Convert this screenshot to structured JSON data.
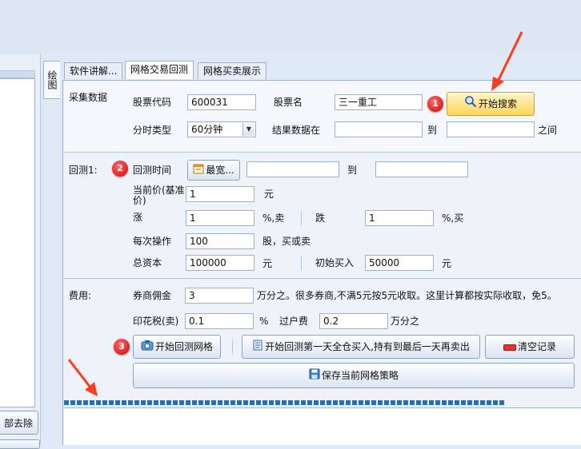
{
  "left": {
    "clear_button_label": "部去除"
  },
  "vertical_tab": {
    "label": "绘图"
  },
  "tabs": [
    {
      "label": "软件讲解..."
    },
    {
      "label": "网格交易回测"
    },
    {
      "label": "网格买卖展示"
    }
  ],
  "collect": {
    "section_label": "采集数据",
    "stock_code_label": "股票代码",
    "stock_code_value": "600031",
    "stock_name_label": "股票名",
    "stock_name_value": "三一重工",
    "search_button": "开始搜索",
    "interval_label": "分时类型",
    "interval_value": "60分钟",
    "result_label": "结果数据在",
    "result_from": "",
    "to_label": "到",
    "result_to": "",
    "between_label": "之间"
  },
  "backtest": {
    "section_label": "回测1:",
    "time_label": "回测时间",
    "browse_button": "最宽...",
    "time_from": "",
    "to_label": "到",
    "time_to": "",
    "current_price_label": "当前价(基准价)",
    "current_price_value": "1",
    "yuan_unit": "元",
    "rise_label": "涨",
    "rise_value": "1",
    "rise_unit": "%,卖",
    "fall_label": "跌",
    "fall_value": "1",
    "fall_unit": "%,买",
    "per_op_label": "每次操作",
    "per_op_value": "100",
    "per_op_unit": "股，买或卖",
    "capital_label": "总资本",
    "capital_value": "100000",
    "capital_unit": "元",
    "initial_buy_label": "初始买入",
    "initial_buy_value": "50000",
    "initial_buy_unit": "元"
  },
  "fees": {
    "section_label": "费用:",
    "commission_label": "券商佣金",
    "commission_value": "3",
    "commission_note": "万分之。很多券商,不满5元按5元收取。这里计算都按实际收取，免5。",
    "stamp_label": "印花税(卖)",
    "stamp_value": "0.1",
    "stamp_unit": "%",
    "transfer_label": "过户费",
    "transfer_value": "0.2",
    "transfer_unit": "万分之"
  },
  "actions": {
    "start_backtest": "开始回测网格",
    "buy_hold": "开始回测第一天全仓买入,持有到最后一天再卖出",
    "clear_log": "清空记录",
    "save_strategy": "保存当前网格策略"
  },
  "badges": {
    "one": "1",
    "two": "2",
    "three": "3"
  },
  "progress": {
    "fraction": 1.0
  },
  "colors": {
    "accent": "#1e6fc4",
    "badge": "#d40000",
    "arrow": "#ff3b1f"
  }
}
